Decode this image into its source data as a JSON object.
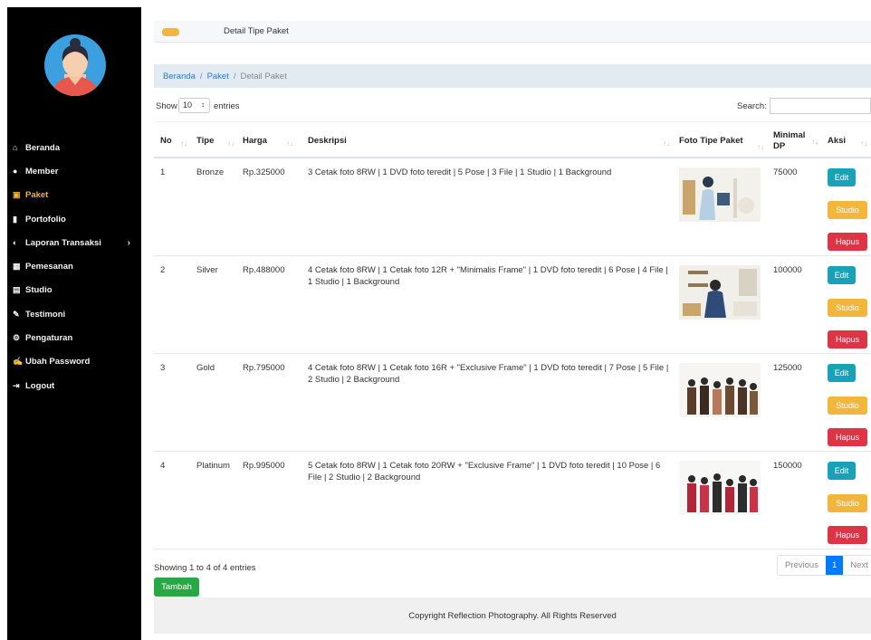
{
  "sidebar": {
    "items": [
      {
        "icon": "home-icon",
        "glyph": "⌂",
        "label": "Beranda"
      },
      {
        "icon": "user-icon",
        "glyph": "●",
        "label": "Member"
      },
      {
        "icon": "image-icon",
        "glyph": "▣",
        "label": "Paket",
        "active": true
      },
      {
        "icon": "book-icon",
        "glyph": "▮",
        "label": "Portofolio"
      },
      {
        "icon": "globe-icon",
        "glyph": "◐",
        "label": "Laporan Transaksi",
        "has_submenu": true
      },
      {
        "icon": "calendar-icon",
        "glyph": "▦",
        "label": "Pemesanan"
      },
      {
        "icon": "studio-icon",
        "glyph": "▤",
        "label": "Studio"
      },
      {
        "icon": "pencil-icon",
        "glyph": "✎",
        "label": "Testimoni"
      },
      {
        "icon": "cog-icon",
        "glyph": "⚙",
        "label": "Pengaturan"
      },
      {
        "icon": "edit-icon",
        "glyph": "✍",
        "label": "Ubah Password"
      },
      {
        "icon": "logout-icon",
        "glyph": "⇥",
        "label": "Logout"
      }
    ]
  },
  "topbar": {
    "title": "Detail Tipe Paket"
  },
  "breadcrumb": {
    "home": "Beranda",
    "paket": "Paket",
    "current": "Detail Paket",
    "separator": "/"
  },
  "controls": {
    "show": "Show",
    "length": "10",
    "entries": "entries",
    "search": "Search:"
  },
  "table": {
    "headers": {
      "no": "No",
      "tipe": "Tipe",
      "harga": "Harga",
      "deskripsi": "Deskripsi",
      "foto": "Foto Tipe Paket",
      "dp": "Minimal DP",
      "aksi": "Aksi"
    },
    "rows": [
      {
        "no": "1",
        "tipe": "Bronze",
        "harga": "Rp.325000",
        "deskripsi": "3 Cetak foto 8RW | 1 DVD foto teredit | 5 Pose | 3 File | 1 Studio | 1 Background",
        "dp": "75000"
      },
      {
        "no": "2",
        "tipe": "Silver",
        "harga": "Rp.488000",
        "deskripsi": "4 Cetak foto 8RW | 1 Cetak foto 12R + \"Minimalis Frame\" | 1 DVD foto teredit | 6 Pose | 4 File | 1 Studio | 1 Background",
        "dp": "100000"
      },
      {
        "no": "3",
        "tipe": "Gold",
        "harga": "Rp.795000",
        "deskripsi": "4 Cetak foto 8RW | 1 Cetak foto 16R + \"Exclusive Frame\" | 1 DVD foto teredit | 7 Pose | 5 File | 2 Studio | 2 Background",
        "dp": "125000"
      },
      {
        "no": "4",
        "tipe": "Platinum",
        "harga": "Rp.995000",
        "deskripsi": "5 Cetak foto 8RW | 1 Cetak foto 20RW + \"Exclusive Frame\" | 1 DVD foto teredit | 10 Pose | 6 File | 2 Studio | 2 Background",
        "dp": "150000"
      }
    ],
    "actions": {
      "edit": "Edit",
      "studio": "Studio",
      "hapus": "Hapus"
    }
  },
  "info": "Showing 1 to 4 of 4 entries",
  "pager": {
    "previous": "Previous",
    "page": "1",
    "next": "Next"
  },
  "tambah": "Tambah",
  "footer": "Copyright Reflection Photography. All Rights Reserved"
}
